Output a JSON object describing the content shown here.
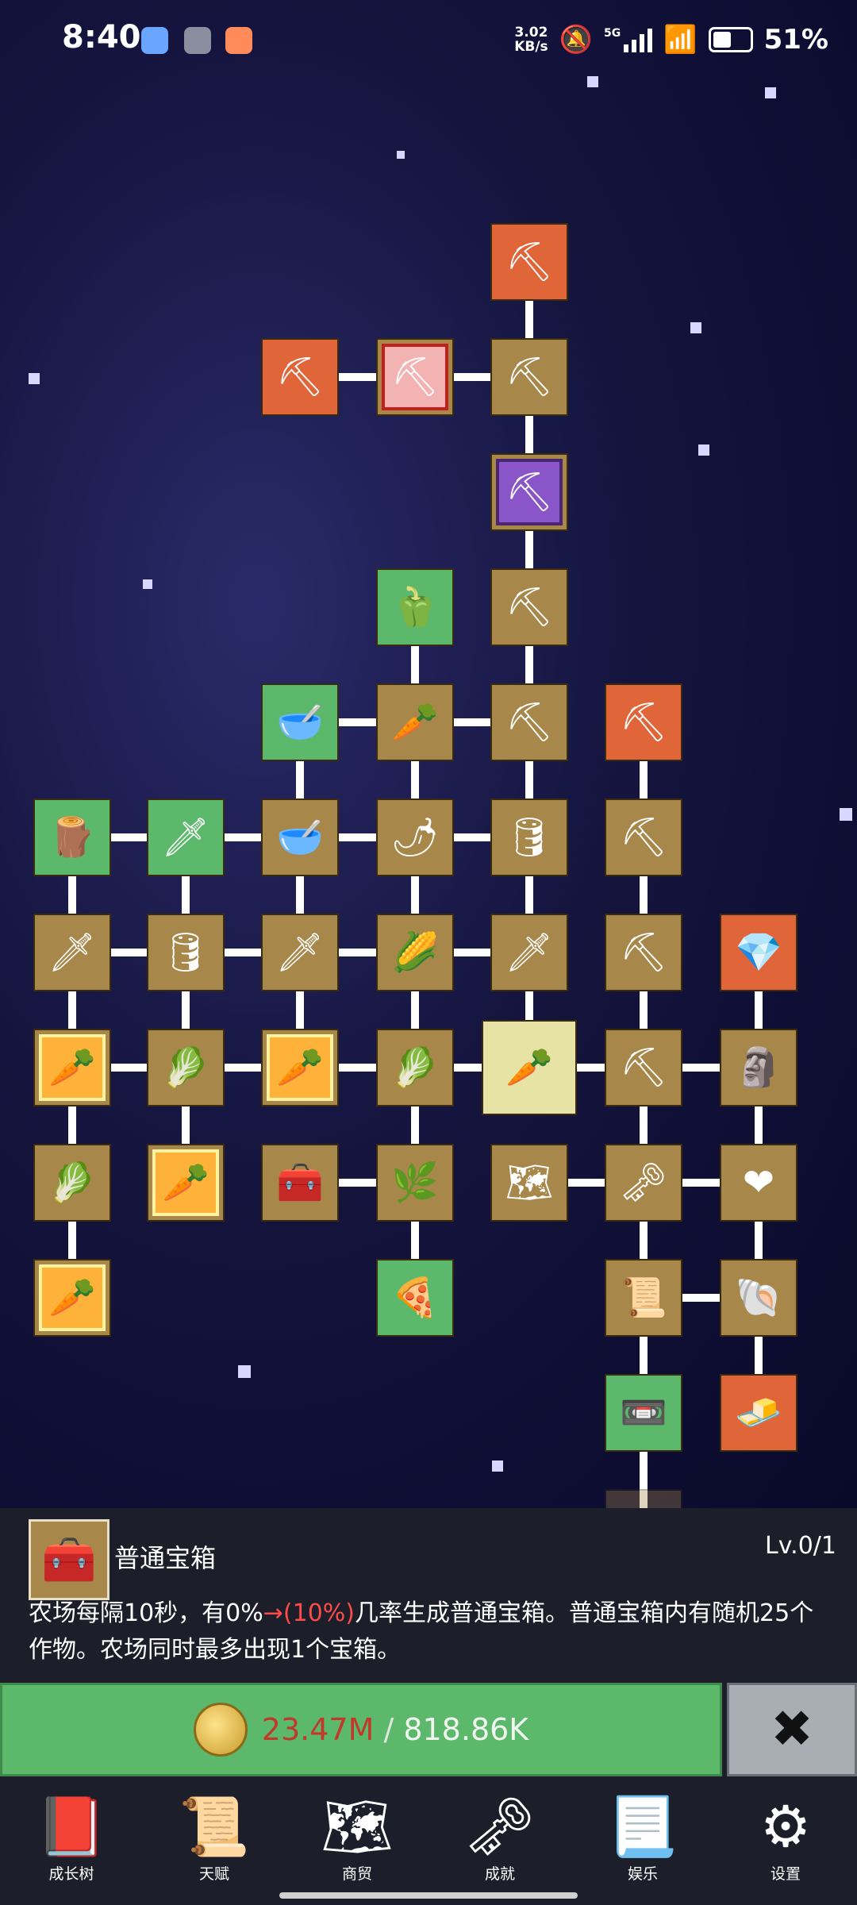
{
  "status": {
    "time": "8:40",
    "net_speed_value": "3.02",
    "net_speed_unit": "KB/s",
    "network_type": "5G",
    "battery": "51%"
  },
  "tree": {
    "nodes": [
      {
        "id": "n1",
        "icon": "shovel-icon",
        "glyph": "⛏",
        "bg": "orange"
      },
      {
        "id": "n2",
        "icon": "shovel-icon",
        "glyph": "⛏",
        "bg": "orange"
      },
      {
        "id": "n3",
        "icon": "shovel-icon",
        "glyph": "⛏",
        "bg": "pink"
      },
      {
        "id": "n4",
        "icon": "shovel-icon",
        "glyph": "⛏",
        "bg": "brown"
      },
      {
        "id": "n5",
        "icon": "shovel-icon",
        "glyph": "⛏",
        "bg": "purple"
      },
      {
        "id": "n6",
        "icon": "pepper-icon",
        "glyph": "🫑",
        "bg": "green"
      },
      {
        "id": "n7",
        "icon": "shovel-icon",
        "glyph": "⛏",
        "bg": "brown"
      },
      {
        "id": "n8",
        "icon": "pot-icon",
        "glyph": "🥣",
        "bg": "green"
      },
      {
        "id": "n9",
        "icon": "radish-icon",
        "glyph": "🥕",
        "bg": "brown"
      },
      {
        "id": "n10",
        "icon": "shovel-icon",
        "glyph": "⛏",
        "bg": "brown"
      },
      {
        "id": "n11",
        "icon": "pickaxe-icon",
        "glyph": "⛏",
        "bg": "orange"
      },
      {
        "id": "n12",
        "icon": "crate-icon",
        "glyph": "🪵",
        "bg": "green"
      },
      {
        "id": "n13",
        "icon": "sword-icon",
        "glyph": "🗡",
        "bg": "green"
      },
      {
        "id": "n14",
        "icon": "pot-icon",
        "glyph": "🥣",
        "bg": "brown"
      },
      {
        "id": "n15",
        "icon": "chili-icon",
        "glyph": "🌶",
        "bg": "brown"
      },
      {
        "id": "n16",
        "icon": "barrel-icon",
        "glyph": "🛢",
        "bg": "brown"
      },
      {
        "id": "n17",
        "icon": "pickaxe-icon",
        "glyph": "⛏",
        "bg": "brown"
      },
      {
        "id": "n18",
        "icon": "sword-icon",
        "glyph": "🗡",
        "bg": "brown"
      },
      {
        "id": "n19",
        "icon": "barrel-icon",
        "glyph": "🛢",
        "bg": "brown"
      },
      {
        "id": "n20",
        "icon": "sword-icon",
        "glyph": "🗡",
        "bg": "brown"
      },
      {
        "id": "n21",
        "icon": "corn-icon",
        "glyph": "🌽",
        "bg": "brown"
      },
      {
        "id": "n22",
        "icon": "dagger-icon",
        "glyph": "🗡",
        "bg": "brown"
      },
      {
        "id": "n23",
        "icon": "pickaxe-icon",
        "glyph": "⛏",
        "bg": "brown"
      },
      {
        "id": "n24",
        "icon": "crystal-icon",
        "glyph": "💎",
        "bg": "orange"
      },
      {
        "id": "n25",
        "icon": "carrot-icon",
        "glyph": "🥕",
        "bg": "glow"
      },
      {
        "id": "n26",
        "icon": "cabbage-icon",
        "glyph": "🥬",
        "bg": "brown"
      },
      {
        "id": "n27",
        "icon": "carrot-icon",
        "glyph": "🥕",
        "bg": "glow"
      },
      {
        "id": "n28",
        "icon": "cabbage-icon",
        "glyph": "🥬",
        "bg": "brown"
      },
      {
        "id": "n29",
        "icon": "carrot-icon",
        "glyph": "🥕",
        "bg": "gold"
      },
      {
        "id": "n30",
        "icon": "pickaxe-icon",
        "glyph": "⛏",
        "bg": "brown"
      },
      {
        "id": "n31",
        "icon": "statue-icon",
        "glyph": "🗿",
        "bg": "brown"
      },
      {
        "id": "n32",
        "icon": "cabbage-icon",
        "glyph": "🥬",
        "bg": "brown"
      },
      {
        "id": "n33",
        "icon": "carrot-icon",
        "glyph": "🥕",
        "bg": "glow"
      },
      {
        "id": "n34",
        "icon": "chest-icon",
        "glyph": "🧰",
        "bg": "brown"
      },
      {
        "id": "n35",
        "icon": "leek-icon",
        "glyph": "🌿",
        "bg": "brown"
      },
      {
        "id": "n36",
        "icon": "map-icon",
        "glyph": "🗺",
        "bg": "brown"
      },
      {
        "id": "n37",
        "icon": "key-icon",
        "glyph": "🗝",
        "bg": "brown"
      },
      {
        "id": "n38",
        "icon": "heart-icon",
        "glyph": "❤",
        "bg": "brown"
      },
      {
        "id": "n39",
        "icon": "carrot-icon",
        "glyph": "🥕",
        "bg": "glow"
      },
      {
        "id": "n40",
        "icon": "pizza-icon",
        "glyph": "🍕",
        "bg": "green"
      },
      {
        "id": "n41",
        "icon": "scroll-icon",
        "glyph": "📜",
        "bg": "brown"
      },
      {
        "id": "n42",
        "icon": "fossil-icon",
        "glyph": "🐚",
        "bg": "brown"
      },
      {
        "id": "n43",
        "icon": "cassette-icon",
        "glyph": "📼",
        "bg": "green"
      },
      {
        "id": "n44",
        "icon": "butter-icon",
        "glyph": "🧈",
        "bg": "orange"
      },
      {
        "id": "n45",
        "icon": "key-icon",
        "glyph": "🗝",
        "bg": "dim"
      }
    ]
  },
  "panel": {
    "item_icon": "chest-icon",
    "title": "普通宝箱",
    "level": "Lv.0/1",
    "desc_before": "农场每隔10秒，有0%",
    "desc_highlight": "→(10%)",
    "desc_after": "几率生成普通宝箱。普通宝箱内有随机25个作物。农场同时最多出现1个宝箱。",
    "cost": "23.47M",
    "separator": " / ",
    "owned": "818.86K",
    "close_label": "✖"
  },
  "nav": [
    {
      "label": "成长树",
      "icon": "book-icon",
      "glyph": "📕"
    },
    {
      "label": "天赋",
      "icon": "scroll-icon",
      "glyph": "📜"
    },
    {
      "label": "商贸",
      "icon": "map-icon",
      "glyph": "🗺"
    },
    {
      "label": "成就",
      "icon": "key-icon",
      "glyph": "🗝"
    },
    {
      "label": "娱乐",
      "icon": "parchment-icon",
      "glyph": "📃"
    },
    {
      "label": "设置",
      "icon": "gear-icon",
      "glyph": "⚙"
    }
  ],
  "colors": {
    "button_green": "#5cb86a",
    "cost_red": "#c0392b",
    "node_brown": "#a7874a",
    "node_orange": "#e0663a",
    "node_green": "#5cb86a"
  }
}
